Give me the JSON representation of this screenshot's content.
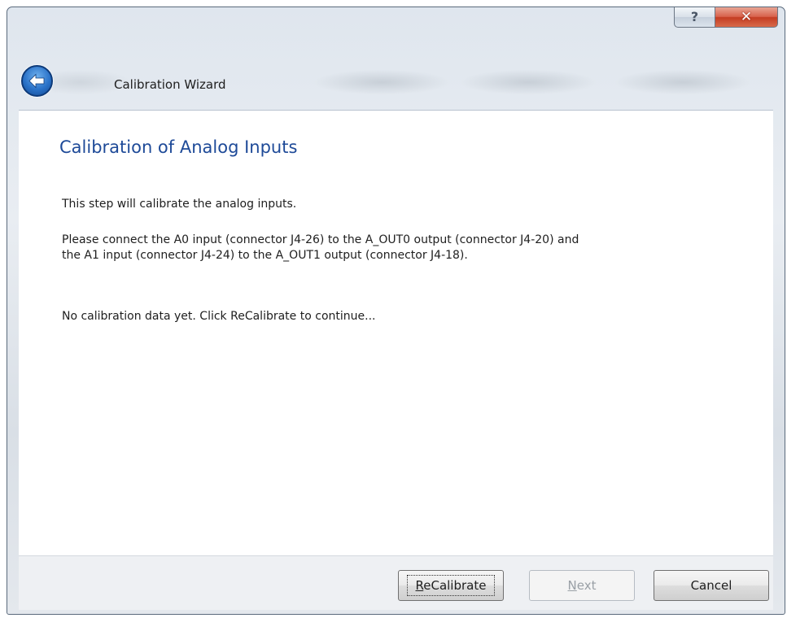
{
  "window": {
    "title": "Calibration Wizard",
    "help_label": "?",
    "close_label": "✕"
  },
  "page": {
    "heading": "Calibration of Analog Inputs",
    "intro": "This step will calibrate the analog inputs.",
    "instructions": [
      "Please connect the A0 input (connector J4-26) to the A_OUT0 output (connector J4-20) and",
      "the A1 input (connector J4-24) to the A_OUT1 output (connector J4-18)."
    ],
    "status": "No calibration data yet. Click ReCalibrate to continue..."
  },
  "buttons": {
    "recalibrate": {
      "accel": "R",
      "rest": "eCalibrate"
    },
    "next": {
      "accel": "N",
      "rest": "ext",
      "enabled": false
    },
    "cancel": "Cancel"
  },
  "colors": {
    "heading": "#1e4a98",
    "close_button": "#c43c22",
    "back_button": "#2a72c8"
  },
  "icons": {
    "back": "back-arrow-icon",
    "help": "help-icon",
    "close": "close-icon"
  }
}
